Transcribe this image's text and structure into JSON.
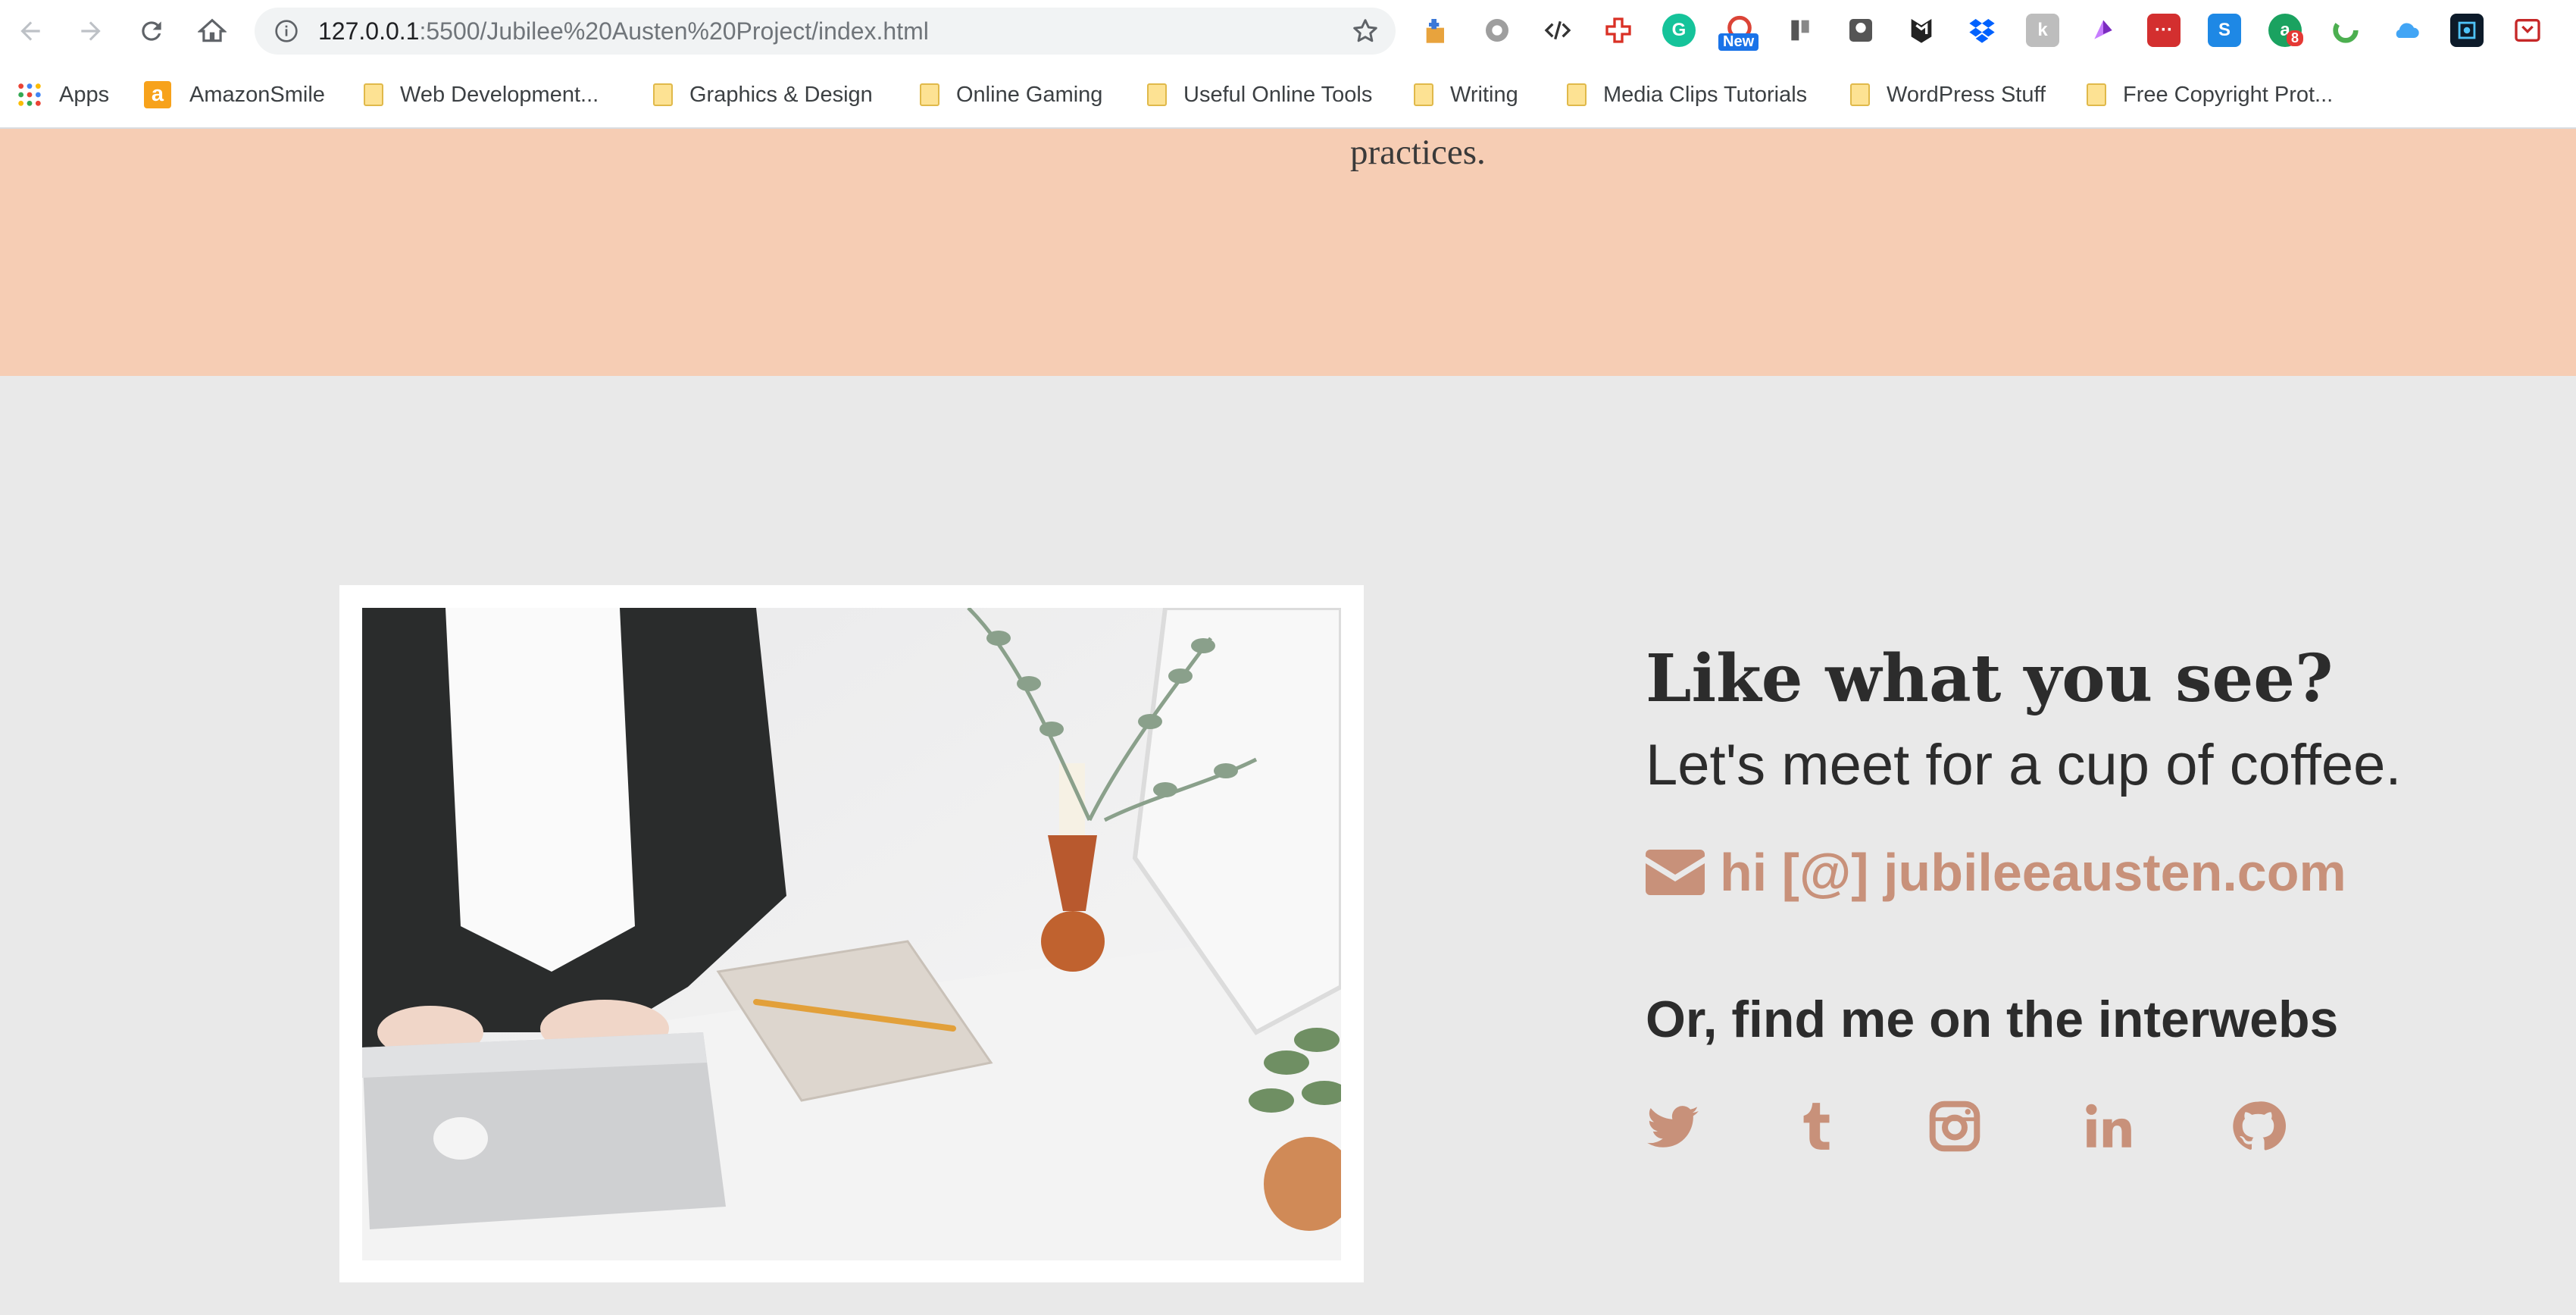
{
  "browser": {
    "url_host": "127.0.0.1",
    "url_rest": ":5500/Jubilee%20Austen%20Project/index.html",
    "extension_badges": {
      "new": "New",
      "count": "8"
    },
    "bookmarks": [
      {
        "label": "Apps",
        "icon": "apps-grid-icon"
      },
      {
        "label": "AmazonSmile",
        "icon": "amazon-icon"
      },
      {
        "label": "Web Development...",
        "icon": "folder-icon"
      },
      {
        "label": "Graphics & Design",
        "icon": "folder-icon"
      },
      {
        "label": "Online Gaming",
        "icon": "folder-icon"
      },
      {
        "label": "Useful Online Tools",
        "icon": "folder-icon"
      },
      {
        "label": "Writing",
        "icon": "folder-icon"
      },
      {
        "label": "Media Clips Tutorials",
        "icon": "folder-icon"
      },
      {
        "label": "WordPress Stuff",
        "icon": "folder-icon"
      },
      {
        "label": "Free Copyright Prot...",
        "icon": "folder-icon"
      }
    ]
  },
  "page": {
    "top_text": "practices.",
    "contact": {
      "heading": "Like what you see?",
      "subheading": "Let's meet for a cup of coffee.",
      "email": "hi [@] jubileeausten.com",
      "social_heading": "Or, find me on the interwebs"
    },
    "social_icons": [
      "twitter-icon",
      "tumblr-icon",
      "instagram-icon",
      "linkedin-icon",
      "github-icon"
    ]
  },
  "colors": {
    "peach_band": "#f6cdb4",
    "page_bg": "#e9e9e9",
    "accent": "#c8917a",
    "text_dark": "#2c2c2c"
  }
}
